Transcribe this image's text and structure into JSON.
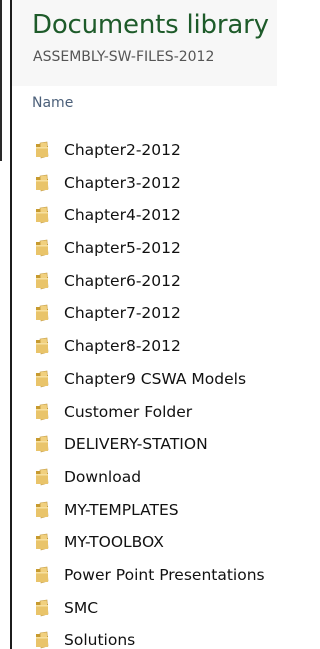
{
  "library": {
    "title": "Documents library",
    "subtitle": "ASSEMBLY-SW-FILES-2012"
  },
  "columns": {
    "name_label": "Name"
  },
  "folders": [
    {
      "label": "Chapter2-2012",
      "icon": "folder-icon"
    },
    {
      "label": "Chapter3-2012",
      "icon": "folder-icon"
    },
    {
      "label": "Chapter4-2012",
      "icon": "folder-icon"
    },
    {
      "label": "Chapter5-2012",
      "icon": "folder-icon"
    },
    {
      "label": "Chapter6-2012",
      "icon": "folder-icon"
    },
    {
      "label": "Chapter7-2012",
      "icon": "folder-icon"
    },
    {
      "label": "Chapter8-2012",
      "icon": "folder-icon"
    },
    {
      "label": "Chapter9 CSWA Models",
      "icon": "folder-icon"
    },
    {
      "label": "Customer Folder",
      "icon": "folder-icon"
    },
    {
      "label": "DELIVERY-STATION",
      "icon": "folder-icon"
    },
    {
      "label": "Download",
      "icon": "folder-icon"
    },
    {
      "label": "MY-TEMPLATES",
      "icon": "folder-icon"
    },
    {
      "label": "MY-TOOLBOX",
      "icon": "folder-icon"
    },
    {
      "label": "Power Point Presentations",
      "icon": "folder-icon"
    },
    {
      "label": "SMC",
      "icon": "folder-icon"
    },
    {
      "label": "Solutions",
      "icon": "folder-icon"
    }
  ],
  "colors": {
    "title": "#1e5b2a",
    "folder_front": "#e9c46a",
    "folder_back": "#c79a2e"
  }
}
